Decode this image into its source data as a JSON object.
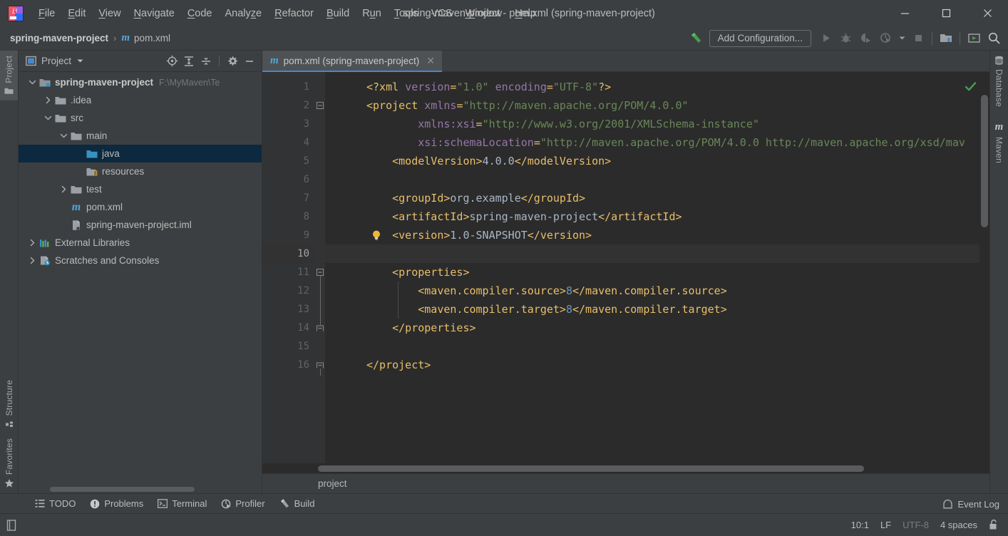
{
  "window": {
    "title": "spring-maven-project - pom.xml (spring-maven-project)",
    "minimize_label": "minimize-window",
    "maximize_label": "maximize-window",
    "close_label": "close-window"
  },
  "menubar": {
    "items": [
      {
        "label": "File",
        "mnemonic": "F"
      },
      {
        "label": "Edit",
        "mnemonic": "E"
      },
      {
        "label": "View",
        "mnemonic": "V"
      },
      {
        "label": "Navigate",
        "mnemonic": "N"
      },
      {
        "label": "Code",
        "mnemonic": "C"
      },
      {
        "label": "Analyze",
        "mnemonic": "z"
      },
      {
        "label": "Refactor",
        "mnemonic": "R"
      },
      {
        "label": "Build",
        "mnemonic": "B"
      },
      {
        "label": "Run",
        "mnemonic": "u"
      },
      {
        "label": "Tools",
        "mnemonic": "T"
      },
      {
        "label": "VCS",
        "mnemonic": ""
      },
      {
        "label": "Window",
        "mnemonic": "W"
      },
      {
        "label": "Help",
        "mnemonic": "H"
      }
    ]
  },
  "navbar": {
    "project_crumb": "spring-maven-project",
    "separator": "›",
    "file_crumb": "pom.xml",
    "file_icon": "m",
    "build_icon": "hammer-icon",
    "add_configuration": "Add Configuration...",
    "run_icon": "run-icon",
    "debug_icon": "debug-icon",
    "run_coverage_icon": "run-with-coverage-icon",
    "profile_icon": "profile-icon",
    "dropdown_icon": "chevron-down-icon",
    "stop_icon": "stop-icon",
    "project_structure_icon": "project-structure-icon",
    "updates_icon": "updates-icon",
    "search_icon": "search-everywhere-icon"
  },
  "left_strip": {
    "project_tab": "Project",
    "structure_tab": "Structure",
    "favorites_tab": "Favorites"
  },
  "right_strip": {
    "database_tab": "Database",
    "maven_tab": "Maven",
    "maven_icon": "m"
  },
  "project_panel": {
    "title": "Project",
    "panel_icon": "project-view-icon",
    "caret_icon": "chevron-down-icon",
    "tools": [
      {
        "name": "locate-icon",
        "title": "Select Opened File"
      },
      {
        "name": "expand-all-icon",
        "title": "Expand All"
      },
      {
        "name": "collapse-all-icon",
        "title": "Collapse All"
      },
      {
        "name": "gear-icon",
        "title": "Settings"
      },
      {
        "name": "hide-icon",
        "title": "Hide"
      }
    ],
    "tree": [
      {
        "label": "spring-maven-project",
        "path": "F:\\MyMaven\\Te",
        "indent": 0,
        "twisty": "down",
        "icon": "module-folder",
        "bold": true,
        "selected": false
      },
      {
        "label": ".idea",
        "path": "",
        "indent": 1,
        "twisty": "right",
        "icon": "folder",
        "bold": false,
        "selected": false
      },
      {
        "label": "src",
        "path": "",
        "indent": 1,
        "twisty": "down",
        "icon": "folder",
        "bold": false,
        "selected": false
      },
      {
        "label": "main",
        "path": "",
        "indent": 2,
        "twisty": "down",
        "icon": "folder",
        "bold": false,
        "selected": false
      },
      {
        "label": "java",
        "path": "",
        "indent": 3,
        "twisty": "none",
        "icon": "source-folder",
        "bold": false,
        "selected": true
      },
      {
        "label": "resources",
        "path": "",
        "indent": 3,
        "twisty": "none",
        "icon": "resource-folder",
        "bold": false,
        "selected": false
      },
      {
        "label": "test",
        "path": "",
        "indent": 2,
        "twisty": "right",
        "icon": "folder",
        "bold": false,
        "selected": false
      },
      {
        "label": "pom.xml",
        "path": "",
        "indent": 2,
        "twisty": "none",
        "icon": "maven-file",
        "bold": false,
        "selected": false
      },
      {
        "label": "spring-maven-project.iml",
        "path": "",
        "indent": 2,
        "twisty": "none",
        "icon": "iml-file",
        "bold": false,
        "selected": false
      },
      {
        "label": "External Libraries",
        "path": "",
        "indent": 0,
        "twisty": "right",
        "icon": "libraries",
        "bold": false,
        "selected": false
      },
      {
        "label": "Scratches and Consoles",
        "path": "",
        "indent": 0,
        "twisty": "right",
        "icon": "scratches",
        "bold": false,
        "selected": false
      }
    ]
  },
  "editor": {
    "tab_label": "pom.xml (spring-maven-project)",
    "tab_icon": "m",
    "tab_close_icon": "close-icon",
    "inspection_status_icon": "check-ok-icon",
    "breadcrumb": "project",
    "bulb_line": 9,
    "current_line": 10,
    "lines": [
      {
        "n": 1,
        "fold": "",
        "tokens": [
          {
            "t": "pi",
            "s": "<?xml "
          },
          {
            "t": "attr",
            "s": "version"
          },
          {
            "t": "pi",
            "s": "="
          },
          {
            "t": "str",
            "s": "\"1.0\""
          },
          {
            "t": "pi",
            "s": " "
          },
          {
            "t": "attr",
            "s": "encoding"
          },
          {
            "t": "pi",
            "s": "="
          },
          {
            "t": "str",
            "s": "\"UTF-8\""
          },
          {
            "t": "pi",
            "s": "?>"
          }
        ]
      },
      {
        "n": 2,
        "fold": "open",
        "tokens": [
          {
            "t": "tag",
            "s": "<project "
          },
          {
            "t": "attr",
            "s": "xmlns"
          },
          {
            "t": "tag",
            "s": "="
          },
          {
            "t": "str",
            "s": "\"http://maven.apache.org/POM/4.0.0\""
          }
        ]
      },
      {
        "n": 3,
        "fold": "",
        "indent": 8,
        "tokens": [
          {
            "t": "attr",
            "s": "xmlns:"
          },
          {
            "t": "attr2",
            "s": "xsi"
          },
          {
            "t": "tag",
            "s": "="
          },
          {
            "t": "str",
            "s": "\"http://www.w3.org/2001/XMLSchema-instance\""
          }
        ]
      },
      {
        "n": 4,
        "fold": "",
        "indent": 8,
        "tokens": [
          {
            "t": "attr",
            "s": "xsi:"
          },
          {
            "t": "attr2",
            "s": "schemaLocation"
          },
          {
            "t": "tag",
            "s": "="
          },
          {
            "t": "str",
            "s": "\"http://maven.apache.org/POM/4.0.0 http://maven.apache.org/xsd/mav"
          }
        ]
      },
      {
        "n": 5,
        "fold": "",
        "indent": 4,
        "tokens": [
          {
            "t": "tag",
            "s": "<modelVersion>"
          },
          {
            "t": "txt",
            "s": "4.0.0"
          },
          {
            "t": "tag",
            "s": "</modelVersion>"
          }
        ]
      },
      {
        "n": 6,
        "fold": "",
        "tokens": []
      },
      {
        "n": 7,
        "fold": "",
        "indent": 4,
        "tokens": [
          {
            "t": "tag",
            "s": "<groupId>"
          },
          {
            "t": "txt",
            "s": "org.example"
          },
          {
            "t": "tag",
            "s": "</groupId>"
          }
        ]
      },
      {
        "n": 8,
        "fold": "",
        "indent": 4,
        "tokens": [
          {
            "t": "tag",
            "s": "<artifactId>"
          },
          {
            "t": "txt",
            "s": "spring-maven-project"
          },
          {
            "t": "tag",
            "s": "</artifactId>"
          }
        ]
      },
      {
        "n": 9,
        "fold": "",
        "indent": 4,
        "tokens": [
          {
            "t": "tag",
            "s": "<version>"
          },
          {
            "t": "txt",
            "s": "1.0-SNAPSHOT"
          },
          {
            "t": "tag",
            "s": "</version>"
          }
        ]
      },
      {
        "n": 10,
        "fold": "",
        "tokens": []
      },
      {
        "n": 11,
        "fold": "open",
        "indent": 4,
        "tokens": [
          {
            "t": "tag",
            "s": "<properties>"
          }
        ]
      },
      {
        "n": 12,
        "fold": "",
        "indent": 8,
        "tokens": [
          {
            "t": "tag",
            "s": "<maven.compiler.source>"
          },
          {
            "t": "num",
            "s": "8"
          },
          {
            "t": "tag",
            "s": "</maven.compiler.source>"
          }
        ]
      },
      {
        "n": 13,
        "fold": "",
        "indent": 8,
        "tokens": [
          {
            "t": "tag",
            "s": "<maven.compiler.target>"
          },
          {
            "t": "num",
            "s": "8"
          },
          {
            "t": "tag",
            "s": "</maven.compiler.target>"
          }
        ]
      },
      {
        "n": 14,
        "fold": "close",
        "indent": 4,
        "tokens": [
          {
            "t": "tag",
            "s": "</properties>"
          }
        ]
      },
      {
        "n": 15,
        "fold": "",
        "tokens": []
      },
      {
        "n": 16,
        "fold": "close",
        "tokens": [
          {
            "t": "tag",
            "s": "</project>"
          }
        ]
      }
    ]
  },
  "toolwindows": [
    {
      "label": "TODO",
      "icon": "todo-icon"
    },
    {
      "label": "Problems",
      "icon": "problems-icon"
    },
    {
      "label": "Terminal",
      "icon": "terminal-icon"
    },
    {
      "label": "Profiler",
      "icon": "profiler-icon"
    },
    {
      "label": "Build",
      "icon": "build-hammer-icon"
    }
  ],
  "statusbar": {
    "event_log": "Event Log",
    "event_log_icon": "balloon-icon",
    "memory_icon": "file-icon",
    "caret_position": "10:1",
    "line_separator": "LF",
    "encoding": "UTF-8",
    "indent": "4 spaces",
    "lock_icon": "unlocked-icon"
  },
  "colors": {
    "accent_blue": "#4a88c7",
    "selection": "#0d293f",
    "editor_bg": "#2b2b2b",
    "panel_bg": "#3c3f41",
    "gutter_bg": "#313335",
    "tag": "#e8bf6a",
    "attr": "#9876aa",
    "string": "#6a8759",
    "text": "#a9b7c6",
    "number": "#6897bb",
    "ok_green": "#499c54"
  }
}
